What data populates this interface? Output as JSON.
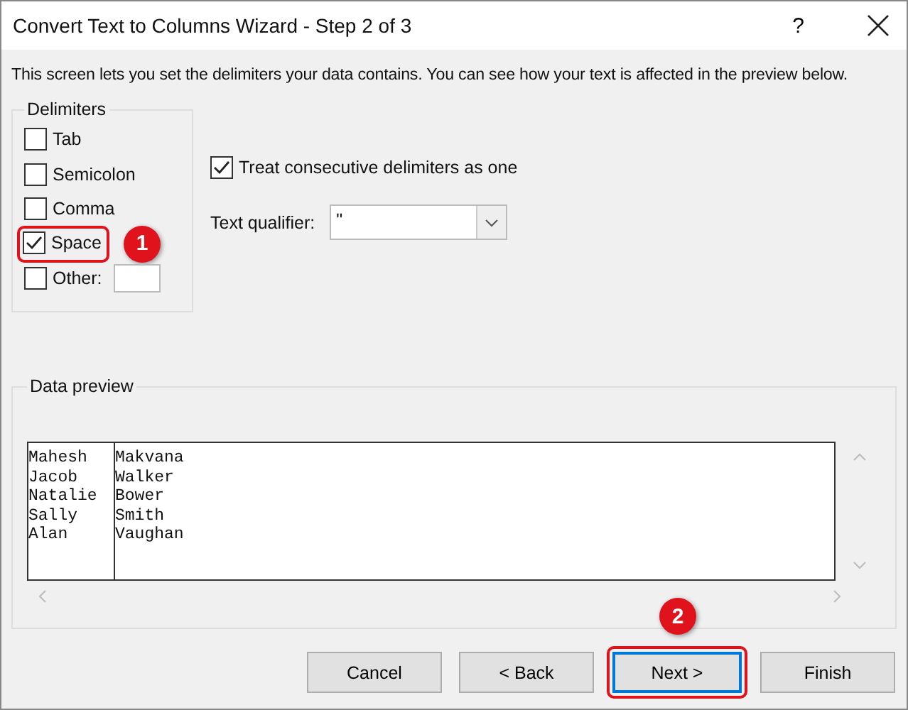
{
  "window": {
    "title": "Convert Text to Columns Wizard - Step 2 of 3",
    "help": "?"
  },
  "instruction": "This screen lets you set the delimiters your data contains.  You can see how your text is affected in the preview below.",
  "delimiters": {
    "title": "Delimiters",
    "items": [
      {
        "label": "Tab",
        "checked": false,
        "kind": "plain"
      },
      {
        "label": "Semicolon",
        "checked": false,
        "kind": "plain"
      },
      {
        "label": "Comma",
        "checked": false,
        "kind": "plain"
      },
      {
        "label": "Space",
        "checked": true,
        "kind": "plain",
        "callout": "1"
      },
      {
        "label": "Other:",
        "checked": false,
        "kind": "other"
      }
    ]
  },
  "consecutive": {
    "label": "Treat consecutive delimiters as one",
    "checked": true
  },
  "text_qualifier": {
    "label": "Text qualifier:",
    "value": "\""
  },
  "data_preview": {
    "title": "Data preview",
    "columns": [
      [
        "Mahesh",
        "Jacob",
        "Natalie",
        "Sally",
        "Alan"
      ],
      [
        "Makvana",
        "Walker",
        "Bower",
        "Smith",
        "Vaughan"
      ]
    ]
  },
  "buttons": [
    {
      "label": "Cancel"
    },
    {
      "label": "< Back"
    },
    {
      "label": "Next >",
      "callout": "2"
    },
    {
      "label": "Finish"
    }
  ]
}
